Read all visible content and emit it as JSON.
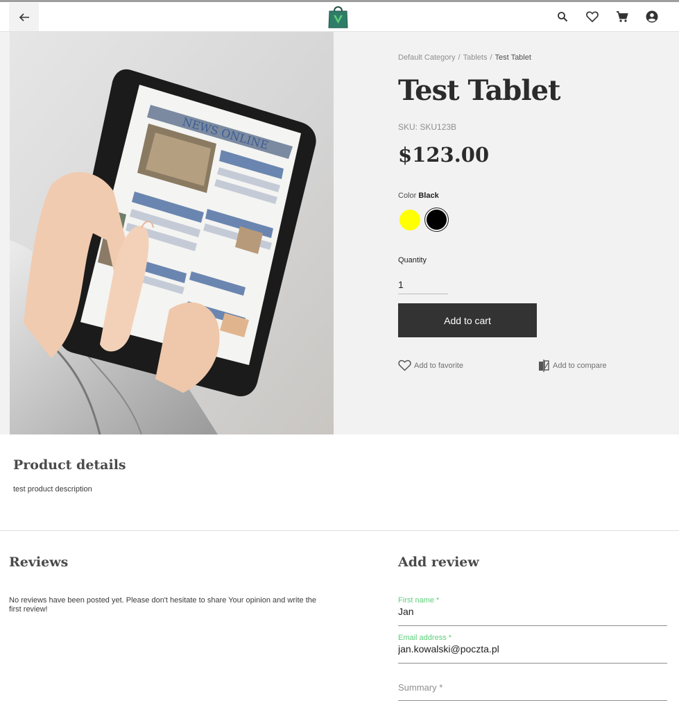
{
  "header": {
    "back_icon": "arrow-left-icon",
    "logo_icon": "shopping-bag-logo-icon",
    "icons": [
      "search-icon",
      "heart-icon",
      "cart-icon",
      "account-icon"
    ]
  },
  "breadcrumb": {
    "items": [
      "Default Category",
      "Tablets"
    ],
    "current": "Test Tablet",
    "separator": "/"
  },
  "product": {
    "title": "Test Tablet",
    "sku": "SKU: SKU123B",
    "price": "$123.00",
    "color_label": "Color",
    "color_selected": "Black",
    "colors": [
      {
        "name": "yellow",
        "hex": "#ffff00"
      },
      {
        "name": "black",
        "hex": "#000000"
      }
    ],
    "quantity_label": "Quantity",
    "quantity_value": "1",
    "add_to_cart": "Add to cart",
    "add_to_favorite": "Add to favorite",
    "add_to_compare": "Add to compare",
    "image_headline": "NEWS ONLINE"
  },
  "details": {
    "title": "Product details",
    "description": "test product description"
  },
  "reviews": {
    "title": "Reviews",
    "empty_text": "No reviews have been posted yet. Please don't hesitate to share Your opinion and write the first review!"
  },
  "add_review": {
    "title": "Add review",
    "first_name_label": "First name *",
    "first_name_value": "Jan",
    "email_label": "Email address *",
    "email_value": "jan.kowalski@poczta.pl",
    "summary_placeholder": "Summary *"
  },
  "colors": {
    "accent": "#5ece7b",
    "button": "#333333",
    "background_light": "#f2f2f2"
  }
}
